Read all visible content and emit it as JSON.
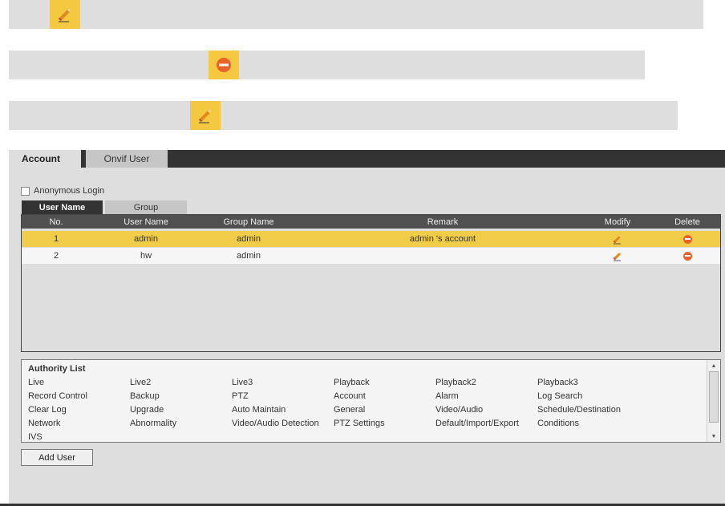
{
  "icons": {
    "modify": "pencil-icon",
    "delete": "delete-icon"
  },
  "colors": {
    "highlight": "#f5c842",
    "selected_row": "#f0cc48",
    "delete": "#e8632a",
    "header": "#505050",
    "tab_dark": "#333333"
  },
  "tabs": {
    "account": "Account",
    "onvif": "Onvif User"
  },
  "anonymous_login": {
    "label": "Anonymous Login",
    "checked": false
  },
  "subtabs": {
    "user_name": "User Name",
    "group": "Group"
  },
  "table": {
    "columns": [
      "No.",
      "User Name",
      "Group Name",
      "Remark",
      "Modify",
      "Delete"
    ],
    "rows": [
      {
        "no": "1",
        "user": "admin",
        "group": "admin",
        "remark": "admin 's account"
      },
      {
        "no": "2",
        "user": "hw",
        "group": "admin",
        "remark": ""
      }
    ]
  },
  "authority": {
    "title": "Authority List",
    "items": [
      [
        "Live",
        "Live2",
        "Live3",
        "Playback",
        "Playback2",
        "Playback3"
      ],
      [
        "Record Control",
        "Backup",
        "PTZ",
        "Account",
        "Alarm",
        "Log Search"
      ],
      [
        "Clear Log",
        "Upgrade",
        "Auto Maintain",
        "General",
        "Video/Audio",
        "Schedule/Destination"
      ],
      [
        "Network",
        "Abnormality",
        "Video/Audio Detection",
        "PTZ Settings",
        "Default/Import/Export",
        "Conditions"
      ],
      [
        "IVS",
        "",
        "",
        "",
        "",
        ""
      ]
    ]
  },
  "add_user_button": "Add User"
}
